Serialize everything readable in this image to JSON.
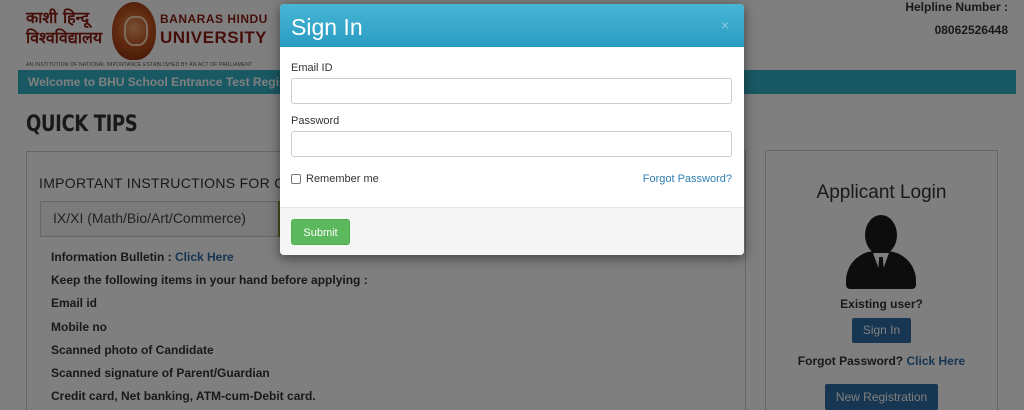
{
  "header": {
    "logo_hindi_line1": "काशी हिन्दू",
    "logo_hindi_line2": "विश्वविद्यालय",
    "logo_eng_line1": "BANARAS HINDU",
    "logo_eng_line2": "UNIVERSITY",
    "logo_tagline": "AN INSTITUTION OF NATIONAL IMPORTANCE ESTABLISHED BY AN ACT OF PARLIAMENT",
    "helpline_label": "Helpline Number :",
    "helpline_number": "08062526448"
  },
  "welcome_text": "Welcome to BHU School Entrance Test Regis",
  "quick_tips_title": "QUICK TIPS",
  "instructions": {
    "title": "IMPORTANT INSTRUCTIONS FOR C",
    "tab_label": "IX/XI (Math/Bio/Art/Commerce)",
    "info_bulletin_label": "Information Bulletin : ",
    "info_bulletin_link": "Click Here",
    "items": [
      "Keep the following items in your hand before applying :",
      "Email id",
      "Mobile no",
      "Scanned photo of Candidate",
      "Scanned signature of Parent/Guardian",
      "Credit card, Net banking, ATM-cum-Debit card."
    ]
  },
  "applicant_login": {
    "title": "Applicant Login",
    "existing_user": "Existing user?",
    "sign_in_button": "Sign In",
    "forgot_label": "Forgot Password? ",
    "forgot_link": "Click Here",
    "new_registration_button": "New Registration"
  },
  "modal": {
    "title": "Sign In",
    "close_symbol": "×",
    "email_label": "Email ID",
    "email_value": "",
    "password_label": "Password",
    "password_value": "",
    "remember_label": "Remember me",
    "forgot_password_link": "Forgot Password?",
    "submit_label": "Submit"
  }
}
